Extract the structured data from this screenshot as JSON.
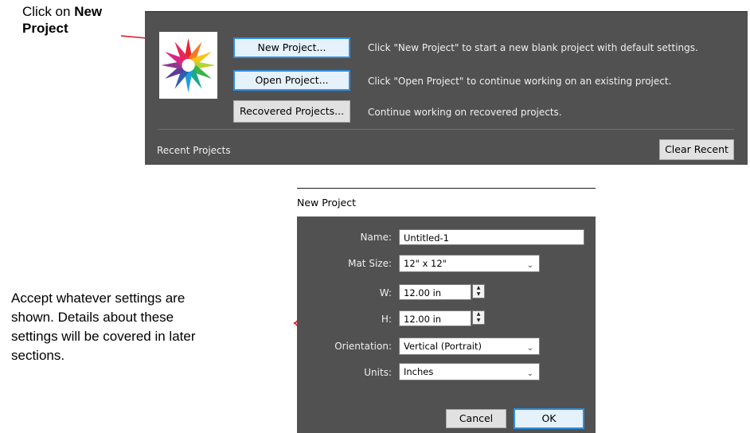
{
  "annotation_top": {
    "prefix": "Click on ",
    "bold1": "New",
    "bold2": "Project"
  },
  "annotation_bottom": {
    "line1": "Accept whatever settings are",
    "line2": "shown. Details about these",
    "line3": "settings will be covered in later",
    "line4": "sections."
  },
  "start_panel": {
    "buttons": [
      {
        "label": "New Project...",
        "description": "Click \"New Project\" to start a new blank project with default settings."
      },
      {
        "label": "Open Project...",
        "description": "Click \"Open Project\" to continue working on an existing project."
      },
      {
        "label": "Recovered Projects...",
        "description": "Continue working on recovered projects."
      }
    ],
    "recent_label": "Recent Projects",
    "clear_recent_label": "Clear Recent"
  },
  "dialog": {
    "title": "New Project",
    "name_label": "Name:",
    "name_value": "Untitled-1",
    "mat_label": "Mat Size:",
    "mat_value": "12\" x 12\"",
    "w_label": "W:",
    "w_value": "12.00 in",
    "h_label": "H:",
    "h_value": "12.00 in",
    "orientation_label": "Orientation:",
    "orientation_value": "Vertical (Portrait)",
    "units_label": "Units:",
    "units_value": "Inches",
    "cancel_label": "Cancel",
    "ok_label": "OK"
  },
  "colors": {
    "panel_bg": "#515151",
    "focus_blue": "#2f8fe0",
    "annotation_red": "#e0141e"
  }
}
